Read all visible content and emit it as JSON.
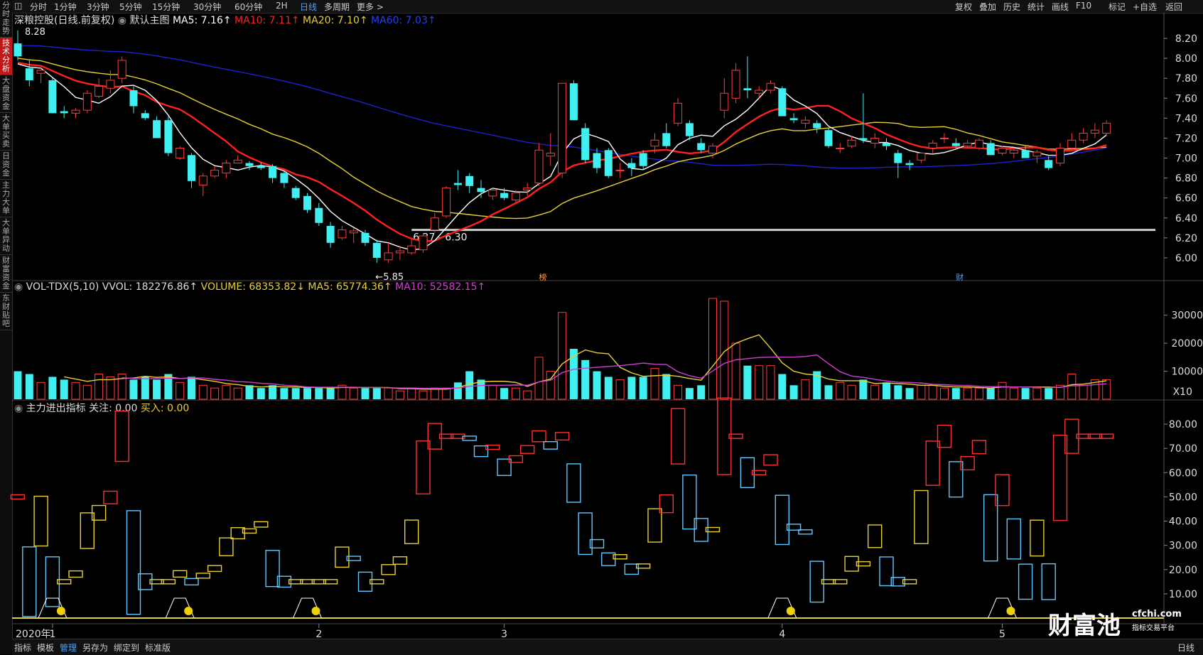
{
  "sidebar": {
    "tabs": [
      {
        "label": "分时走势",
        "active": false
      },
      {
        "label": "技术分析",
        "active": true
      },
      {
        "label": "大盘资金",
        "active": false
      },
      {
        "label": "大单买卖",
        "active": false
      },
      {
        "label": "日资金",
        "active": false
      },
      {
        "label": "主力大单",
        "active": false
      },
      {
        "label": "大单异动",
        "active": false
      },
      {
        "label": "财富资金",
        "active": false
      },
      {
        "label": "东财贴吧",
        "active": false
      }
    ]
  },
  "topbar": {
    "periods": [
      "分时",
      "1分钟",
      "3分钟",
      "5分钟",
      "15分钟",
      "30分钟",
      "60分钟",
      "2H",
      "日线",
      "多周期",
      "更多 >"
    ],
    "active_period": "日线",
    "tools": [
      "复权",
      "叠加",
      "历史",
      "统计",
      "画线",
      "F10",
      "标记",
      "+自选",
      "返回"
    ]
  },
  "main_header": {
    "name": "深粮控股(日线.前复权)",
    "template": "默认主图",
    "ma5": "MA5: 7.16↑",
    "ma10": "MA10: 7.11↑",
    "ma20": "MA20: 7.10↑",
    "ma60": "MA60: 7.03↑"
  },
  "vol_header": {
    "title": "VOL-TDX(5,10) VVOL: 182276.86↑",
    "volume": "VOLUME: 68353.82↓",
    "ma5": "MA5: 65774.36↑",
    "ma10": "MA10: 52582.15↑"
  },
  "ind_header": {
    "title": "主力进出指标 关注: 0.00",
    "buy": "买入: 0.00"
  },
  "colors": {
    "up": "#ff3b3b",
    "down": "#40f0f0",
    "ma5": "#ffffff",
    "ma10": "#ff2020",
    "ma20": "#e8d030",
    "ma60": "#2020d0",
    "ma_vol10": "#d040d0",
    "price_line": "#cccccc"
  },
  "annotations": {
    "high": "8.28",
    "low": "←5.85",
    "range": "6.27 - 6.30",
    "marker_bang": "榜",
    "marker_cai": "财",
    "x10": "X10",
    "year": "2020年"
  },
  "x_months": [
    {
      "label": "1",
      "i": 3
    },
    {
      "label": "2",
      "i": 26
    },
    {
      "label": "3",
      "i": 42
    },
    {
      "label": "4",
      "i": 66
    },
    {
      "label": "5",
      "i": 85
    }
  ],
  "brand": {
    "name": "财富池",
    "url": "cfchi.com",
    "slogan": "指标交易平台"
  },
  "bottombar": {
    "tabs": [
      "指标",
      "模板",
      "管理",
      "另存为",
      "绑定到",
      "标准版"
    ],
    "active": "管理",
    "right": "日线"
  },
  "chart_data": [
    {
      "type": "candlestick",
      "title": "深粮控股(日线.前复权)",
      "ylim": [
        5.8,
        8.3
      ],
      "y_ticks": [
        "8.20",
        "8.00",
        "7.80",
        "7.60",
        "7.40",
        "7.20",
        "7.00",
        "6.80",
        "6.60",
        "6.40",
        "6.20",
        "6.00"
      ],
      "ohlc": [
        [
          8.15,
          8.28,
          7.98,
          8.02
        ],
        [
          7.9,
          7.98,
          7.72,
          7.78
        ],
        [
          7.85,
          7.92,
          7.75,
          7.88
        ],
        [
          7.78,
          7.8,
          7.45,
          7.45
        ],
        [
          7.47,
          7.52,
          7.4,
          7.45
        ],
        [
          7.45,
          7.5,
          7.4,
          7.48
        ],
        [
          7.48,
          7.68,
          7.45,
          7.65
        ],
        [
          7.62,
          7.8,
          7.6,
          7.72
        ],
        [
          7.7,
          7.88,
          7.65,
          7.78
        ],
        [
          7.8,
          8.02,
          7.75,
          7.98
        ],
        [
          7.68,
          7.72,
          7.45,
          7.52
        ],
        [
          7.45,
          7.48,
          7.38,
          7.4
        ],
        [
          7.38,
          7.42,
          7.2,
          7.2
        ],
        [
          7.38,
          7.42,
          7.02,
          7.05
        ],
        [
          7.0,
          7.12,
          6.98,
          7.1
        ],
        [
          7.03,
          7.05,
          6.7,
          6.77
        ],
        [
          6.73,
          6.85,
          6.62,
          6.82
        ],
        [
          6.82,
          6.92,
          6.8,
          6.88
        ],
        [
          6.85,
          6.98,
          6.8,
          6.95
        ],
        [
          6.95,
          7.03,
          6.95,
          6.98
        ],
        [
          6.95,
          6.97,
          6.88,
          6.92
        ],
        [
          6.92,
          6.96,
          6.88,
          6.9
        ],
        [
          6.92,
          6.94,
          6.75,
          6.8
        ],
        [
          6.85,
          6.88,
          6.7,
          6.75
        ],
        [
          6.7,
          6.72,
          6.58,
          6.6
        ],
        [
          6.62,
          6.65,
          6.45,
          6.48
        ],
        [
          6.5,
          6.55,
          6.32,
          6.35
        ],
        [
          6.32,
          6.36,
          6.1,
          6.15
        ],
        [
          6.2,
          6.32,
          6.18,
          6.28
        ],
        [
          6.25,
          6.3,
          6.15,
          6.27
        ],
        [
          6.25,
          6.28,
          6.12,
          6.15
        ],
        [
          6.15,
          6.18,
          5.95,
          6.0
        ],
        [
          5.98,
          6.15,
          5.95,
          6.05
        ],
        [
          6.05,
          6.12,
          5.98,
          6.07
        ],
        [
          6.05,
          6.18,
          6.03,
          6.12
        ],
        [
          6.08,
          6.25,
          6.05,
          6.22
        ],
        [
          6.28,
          6.45,
          6.25,
          6.4
        ],
        [
          6.42,
          6.72,
          6.4,
          6.7
        ],
        [
          6.75,
          6.88,
          6.68,
          6.73
        ],
        [
          6.82,
          6.85,
          6.65,
          6.72
        ],
        [
          6.7,
          6.78,
          6.6,
          6.66
        ],
        [
          6.62,
          6.7,
          6.58,
          6.68
        ],
        [
          6.65,
          6.7,
          6.58,
          6.6
        ],
        [
          6.58,
          6.68,
          6.55,
          6.65
        ],
        [
          6.68,
          6.75,
          6.62,
          6.7
        ],
        [
          6.75,
          7.15,
          6.72,
          7.08
        ],
        [
          7.02,
          7.25,
          6.92,
          7.05
        ],
        [
          6.85,
          7.75,
          6.8,
          7.75
        ],
        [
          7.75,
          7.78,
          7.38,
          7.38
        ],
        [
          7.3,
          7.35,
          6.95,
          6.98
        ],
        [
          7.05,
          7.1,
          6.85,
          6.9
        ],
        [
          7.08,
          7.1,
          6.8,
          6.82
        ],
        [
          6.88,
          6.95,
          6.8,
          6.88
        ],
        [
          6.95,
          7.0,
          6.82,
          6.9
        ],
        [
          7.05,
          7.08,
          6.88,
          6.92
        ],
        [
          7.12,
          7.25,
          7.05,
          7.18
        ],
        [
          7.25,
          7.35,
          7.1,
          7.12
        ],
        [
          7.35,
          7.6,
          7.32,
          7.55
        ],
        [
          7.35,
          7.38,
          7.18,
          7.22
        ],
        [
          7.15,
          7.2,
          7.05,
          7.08
        ],
        [
          7.05,
          7.15,
          7.0,
          7.12
        ],
        [
          7.48,
          7.8,
          7.4,
          7.65
        ],
        [
          7.6,
          7.95,
          7.55,
          7.88
        ],
        [
          7.7,
          8.02,
          7.6,
          7.68
        ],
        [
          7.65,
          7.72,
          7.6,
          7.68
        ],
        [
          7.68,
          7.78,
          7.65,
          7.75
        ],
        [
          7.7,
          7.72,
          7.42,
          7.42
        ],
        [
          7.4,
          7.45,
          7.35,
          7.38
        ],
        [
          7.35,
          7.42,
          7.3,
          7.38
        ],
        [
          7.35,
          7.38,
          7.25,
          7.3
        ],
        [
          7.28,
          7.3,
          7.1,
          7.12
        ],
        [
          7.1,
          7.15,
          7.05,
          7.1
        ],
        [
          7.12,
          7.22,
          7.1,
          7.18
        ],
        [
          7.2,
          7.65,
          7.15,
          7.18
        ],
        [
          7.15,
          7.25,
          7.1,
          7.2
        ],
        [
          7.15,
          7.2,
          7.08,
          7.12
        ],
        [
          7.05,
          7.08,
          6.8,
          6.95
        ],
        [
          6.95,
          6.98,
          6.88,
          6.93
        ],
        [
          6.98,
          7.05,
          6.95,
          7.05
        ],
        [
          7.1,
          7.18,
          7.05,
          7.15
        ],
        [
          7.2,
          7.25,
          7.15,
          7.2
        ],
        [
          7.15,
          7.2,
          7.1,
          7.12
        ],
        [
          7.12,
          7.18,
          7.1,
          7.15
        ],
        [
          7.1,
          7.2,
          7.08,
          7.18
        ],
        [
          7.15,
          7.18,
          7.03,
          7.03
        ],
        [
          7.05,
          7.12,
          7.03,
          7.1
        ],
        [
          7.05,
          7.1,
          7.0,
          7.08
        ],
        [
          7.08,
          7.12,
          7.0,
          7.0
        ],
        [
          7.02,
          7.08,
          6.95,
          7.06
        ],
        [
          6.98,
          7.02,
          6.88,
          6.9
        ],
        [
          6.95,
          7.15,
          6.92,
          7.1
        ],
        [
          7.1,
          7.25,
          7.08,
          7.18
        ],
        [
          7.18,
          7.3,
          7.15,
          7.25
        ],
        [
          7.25,
          7.35,
          7.2,
          7.28
        ],
        [
          7.25,
          7.38,
          7.22,
          7.35
        ]
      ]
    },
    {
      "type": "bar",
      "title": "VOL-TDX(5,10)",
      "y_ticks": [
        "30000",
        "20000",
        "10000"
      ],
      "ylim": [
        0,
        36000
      ],
      "unit": "X10",
      "volume": [
        10000,
        9000,
        6000,
        8000,
        7000,
        6000,
        5000,
        9000,
        8000,
        9000,
        7000,
        8000,
        7000,
        9000,
        6000,
        8000,
        5000,
        4000,
        5000,
        4000,
        5000,
        4000,
        5000,
        4000,
        4000,
        4000,
        4000,
        4000,
        5000,
        4000,
        4000,
        4000,
        4000,
        3000,
        4000,
        3000,
        4000,
        4000,
        6000,
        10000,
        7000,
        5000,
        4000,
        4000,
        3000,
        15000,
        10000,
        31000,
        18000,
        14000,
        10000,
        8000,
        7000,
        8000,
        8000,
        11000,
        9000,
        5000,
        4000,
        5000,
        36000,
        35000,
        20000,
        12000,
        12000,
        12000,
        9000,
        5000,
        7000,
        10000,
        5000,
        6000,
        5000,
        7000,
        5000,
        6000,
        5000,
        4000,
        5000,
        5000,
        4000,
        4000,
        4000,
        4000,
        4000,
        6000,
        4000,
        4000,
        4000,
        4000,
        5000,
        9000,
        5000,
        7000,
        7000
      ]
    }
  ]
}
